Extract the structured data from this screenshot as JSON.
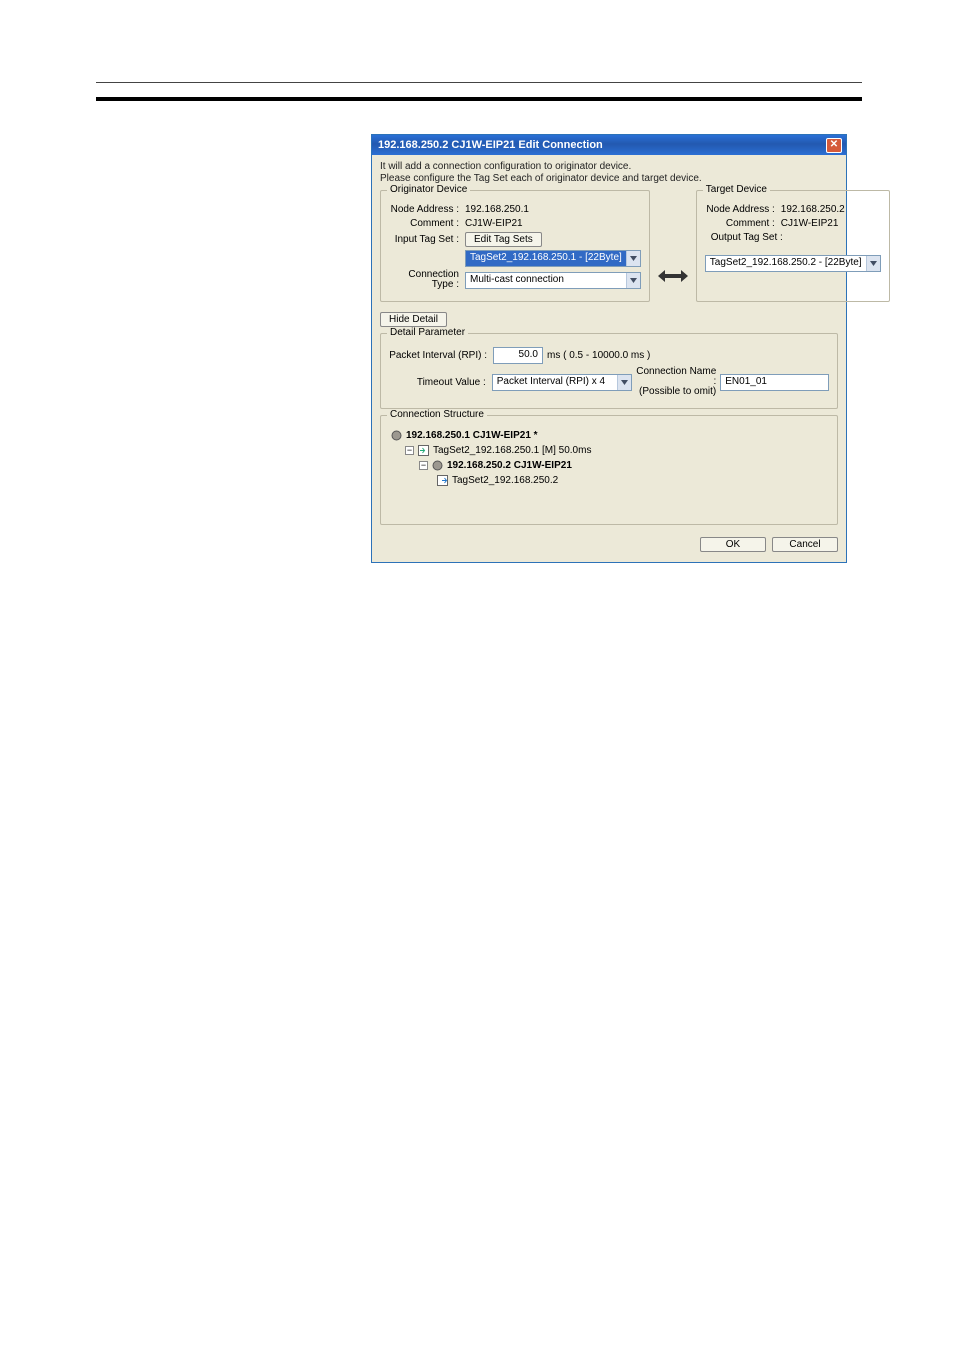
{
  "dialog": {
    "title": "192.168.250.2 CJ1W-EIP21 Edit Connection",
    "intro_line1": "It will add a connection configuration to originator device.",
    "intro_line2": "Please configure the Tag Set each of originator device and target device."
  },
  "originator": {
    "legend": "Originator Device",
    "node_address_label": "Node Address :",
    "node_address_value": "192.168.250.1",
    "comment_label": "Comment :",
    "comment_value": "CJ1W-EIP21",
    "input_tag_set_label": "Input Tag Set :",
    "edit_tag_sets_btn": "Edit Tag Sets",
    "input_tag_set_value": "TagSet2_192.168.250.1 - [22Byte]",
    "connection_type_label_line1": "Connection",
    "connection_type_label_line2": "Type :",
    "connection_type_value": "Multi-cast connection"
  },
  "target": {
    "legend": "Target Device",
    "node_address_label": "Node Address :",
    "node_address_value": "192.168.250.2",
    "comment_label": "Comment :",
    "comment_value": "CJ1W-EIP21",
    "output_tag_set_label": "Output Tag Set :",
    "output_tag_set_value": "TagSet2_192.168.250.2 - [22Byte]"
  },
  "hide_detail_btn": "Hide Detail",
  "detail": {
    "legend": "Detail Parameter",
    "rpi_label": "Packet Interval (RPI) :",
    "rpi_value": "50.0",
    "rpi_hint": "ms ( 0.5 - 10000.0 ms )",
    "timeout_label": "Timeout Value :",
    "timeout_value": "Packet Interval (RPI) x 4",
    "conn_name_label_line1": "Connection Name :",
    "conn_name_label_line2": "(Possible to omit)",
    "conn_name_value": "EN01_01"
  },
  "structure": {
    "legend": "Connection Structure",
    "n1": "192.168.250.1 CJ1W-EIP21 *",
    "n2": "TagSet2_192.168.250.1 [M] 50.0ms",
    "n3": "192.168.250.2 CJ1W-EIP21",
    "n4": "TagSet2_192.168.250.2"
  },
  "footer": {
    "ok": "OK",
    "cancel": "Cancel"
  }
}
